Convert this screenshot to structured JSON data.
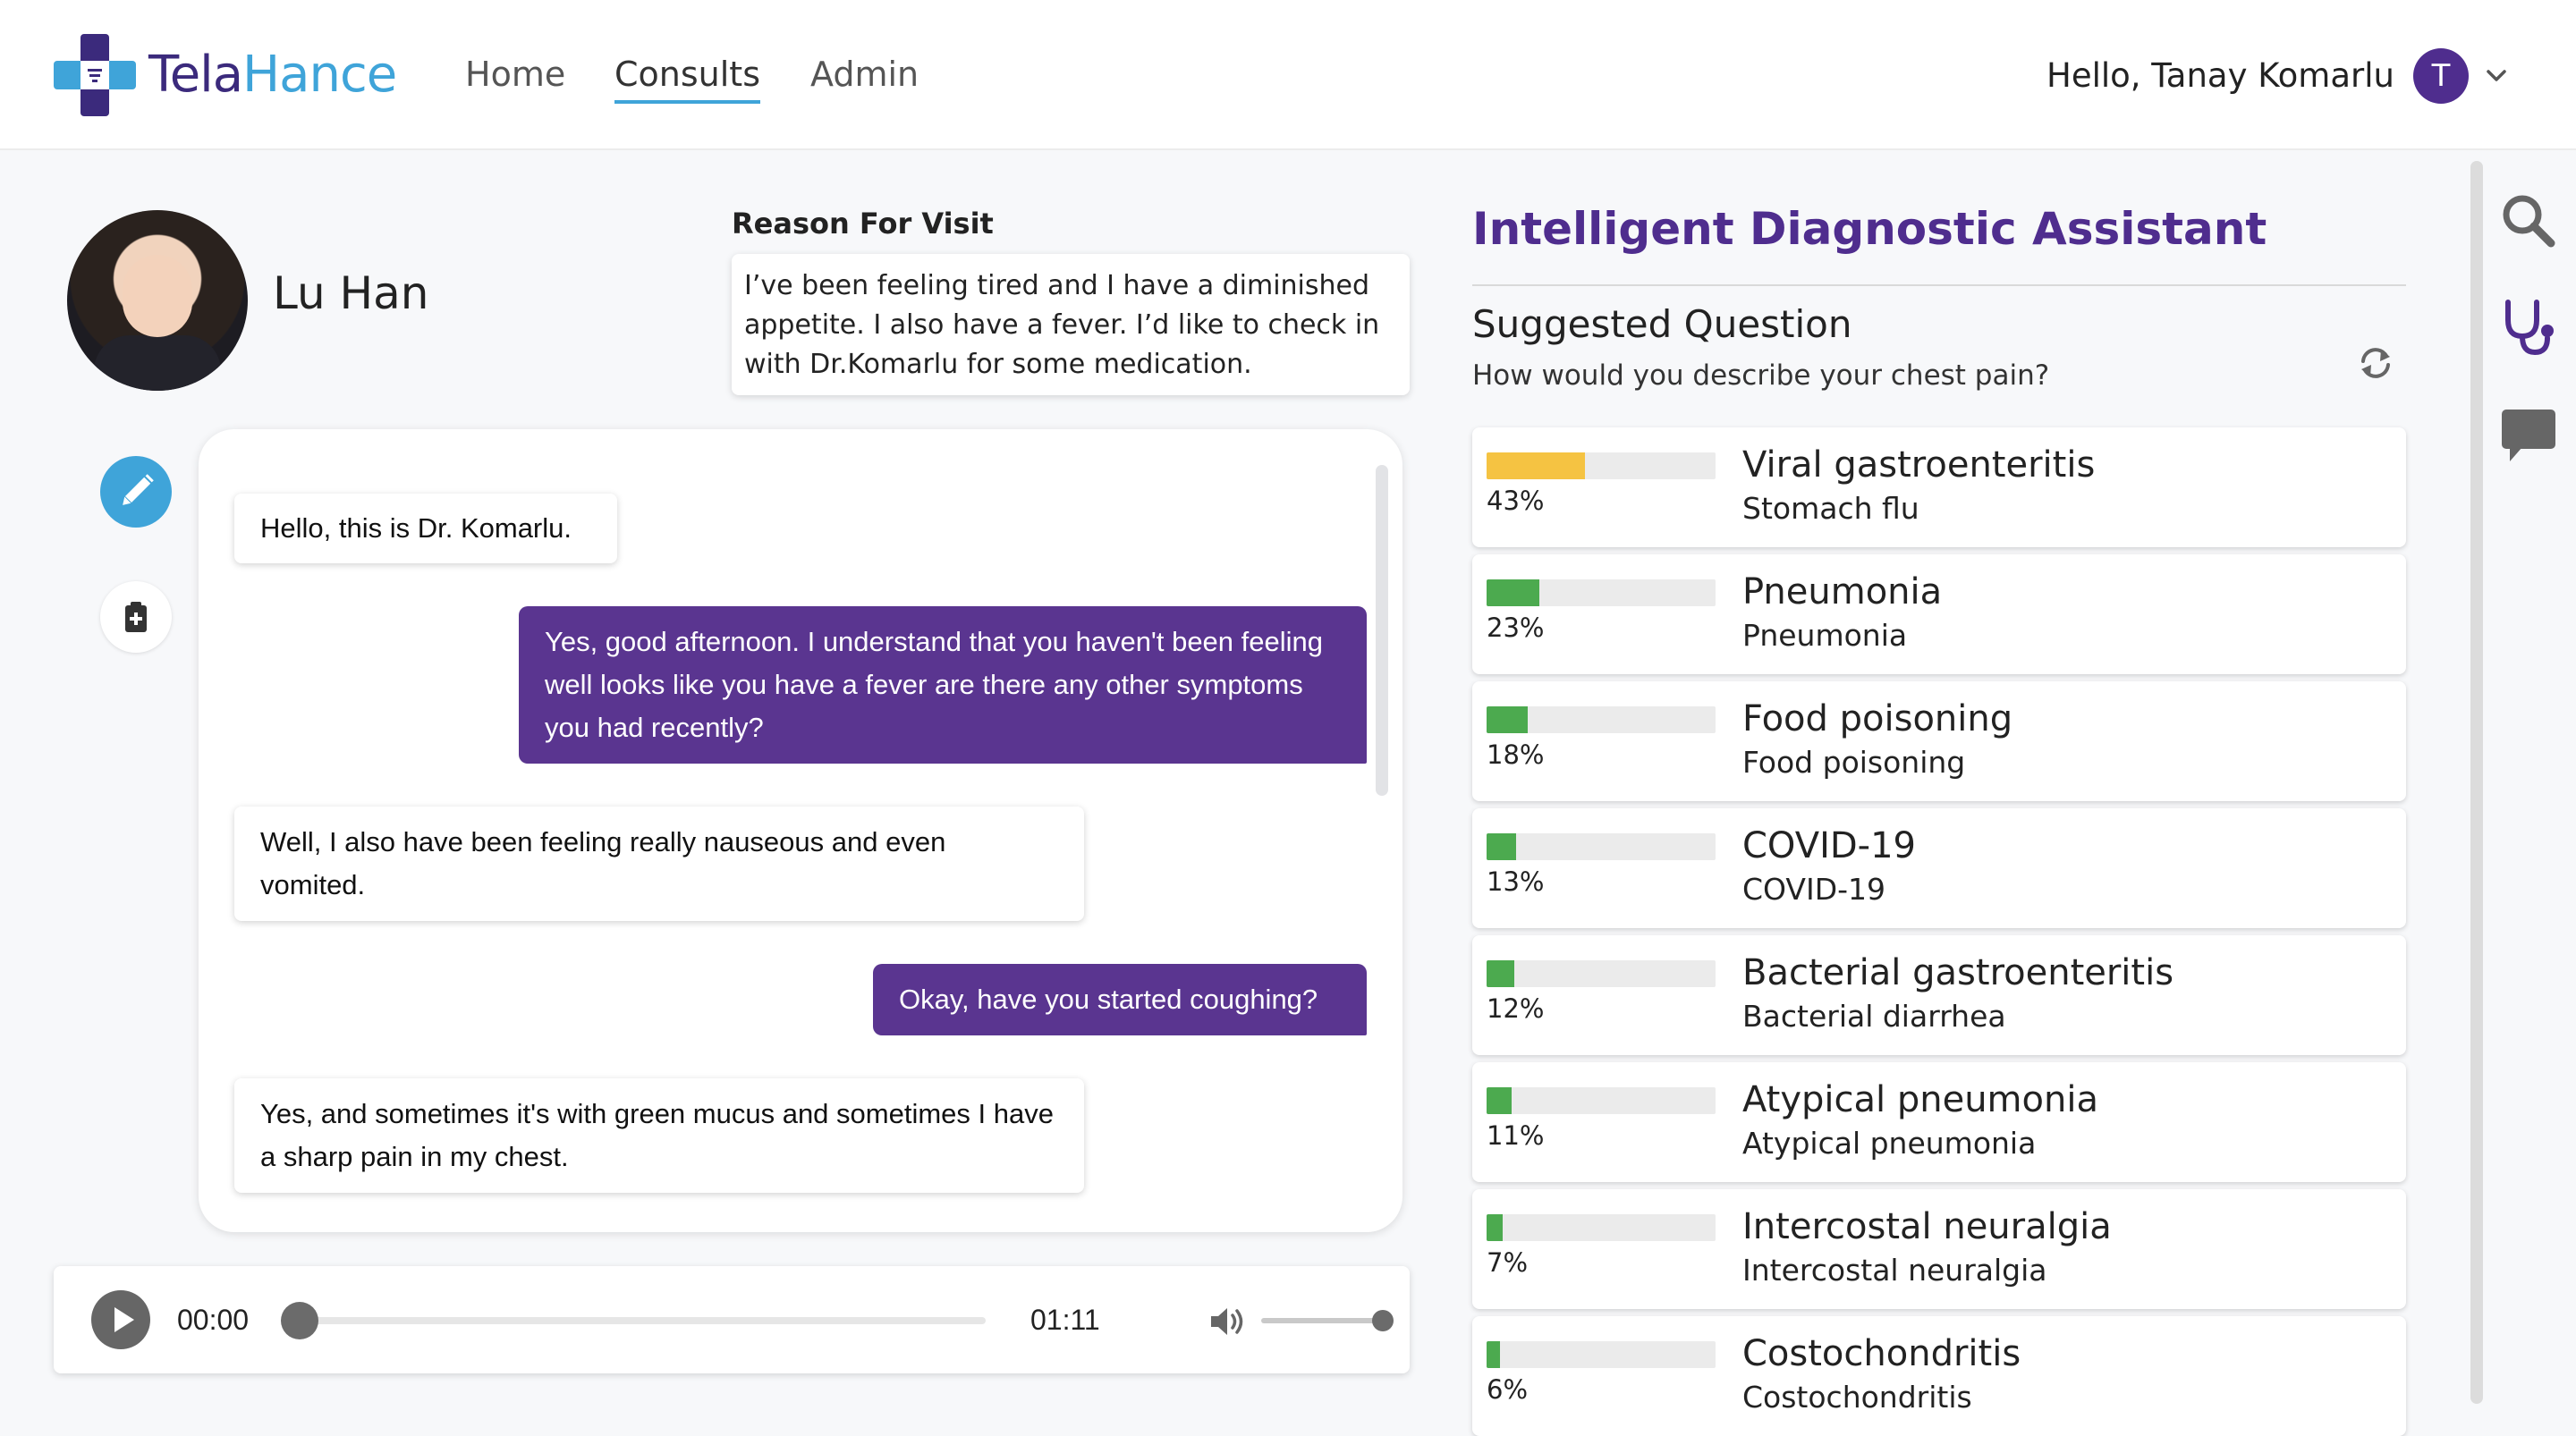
{
  "header": {
    "brand_part1": "Tela",
    "brand_part2": "Hance",
    "nav": [
      {
        "label": "Home"
      },
      {
        "label": "Consults"
      },
      {
        "label": "Admin"
      }
    ],
    "greeting": "Hello, Tanay Komarlu",
    "user_initial": "T"
  },
  "patient": {
    "name": "Lu Han",
    "reason_label": "Reason For Visit",
    "reason_text": "I’ve been feeling tired and I have a diminished appetite. I also have a fever. I’d like to check in with Dr.Komarlu for some medication."
  },
  "chat": {
    "messages": [
      {
        "role": "doctor",
        "text": "Hello, this is Dr. Komarlu."
      },
      {
        "role": "patient",
        "text": "Yes, good afternoon. I understand that you haven't been feeling well looks like you have a fever are there any other symptoms you had recently?"
      },
      {
        "role": "doctor",
        "text": "Well, I also have been feeling really nauseous and even vomited."
      },
      {
        "role": "patient",
        "text": "Okay, have you started coughing?"
      },
      {
        "role": "doctor",
        "text": "Yes, and sometimes it's with green mucus and sometimes I have a sharp pain in my chest."
      }
    ]
  },
  "player": {
    "current_time": "00:00",
    "duration": "01:11",
    "progress": 0,
    "volume": 1.0
  },
  "assistant": {
    "title": "Intelligent Diagnostic Assistant",
    "suggested_label": "Suggested Question",
    "suggested_question": "How would you describe your chest pain?",
    "diagnoses": [
      {
        "pct_label": "43%",
        "value": 43,
        "color": "#f5c342",
        "name": "Viral gastroenteritis",
        "common": "Stomach flu"
      },
      {
        "pct_label": "23%",
        "value": 23,
        "color": "#4caa4f",
        "name": "Pneumonia",
        "common": "Pneumonia"
      },
      {
        "pct_label": "18%",
        "value": 18,
        "color": "#4caa4f",
        "name": "Food poisoning",
        "common": "Food poisoning"
      },
      {
        "pct_label": "13%",
        "value": 13,
        "color": "#4caa4f",
        "name": "COVID-19",
        "common": "COVID-19"
      },
      {
        "pct_label": "12%",
        "value": 12,
        "color": "#4caa4f",
        "name": "Bacterial gastroenteritis",
        "common": "Bacterial diarrhea"
      },
      {
        "pct_label": "11%",
        "value": 11,
        "color": "#4caa4f",
        "name": "Atypical pneumonia",
        "common": "Atypical pneumonia"
      },
      {
        "pct_label": "7%",
        "value": 7,
        "color": "#4caa4f",
        "name": "Intercostal neuralgia",
        "common": "Intercostal neuralgia"
      },
      {
        "pct_label": "6%",
        "value": 6,
        "color": "#4caa4f",
        "name": "Costochondritis",
        "common": "Costochondritis"
      }
    ]
  },
  "colors": {
    "brand_purple": "#4f2d8e",
    "brand_blue": "#3fa4d9",
    "patient_bubble": "#5a3590"
  },
  "icons": [
    "search-icon",
    "stethoscope-icon",
    "chat-icon",
    "pencil-icon",
    "clipboard-icon",
    "refresh-icon",
    "play-icon",
    "volume-icon",
    "chevron-down-icon"
  ]
}
